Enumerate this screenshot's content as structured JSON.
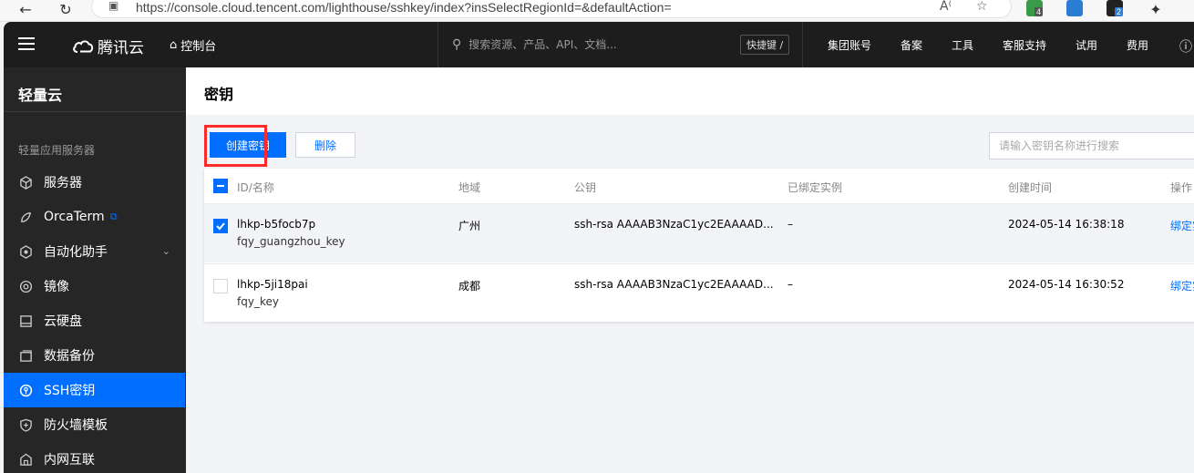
{
  "browser": {
    "url": "https://console.cloud.tencent.com/lighthouse/sshkey/index?insSelectRegionId=&defaultAction=",
    "extensions": [
      {
        "name": "ext-shield",
        "color": "#3a9a4a",
        "badge": "4"
      },
      {
        "name": "ext-note",
        "color": "#2b7cd3",
        "badge": ""
      },
      {
        "name": "ext-dark",
        "color": "#222222",
        "badge": "2"
      }
    ]
  },
  "topnav": {
    "logo_text": "腾讯云",
    "console": "控制台",
    "search_placeholder": "搜索资源、产品、API、文档...",
    "shortcut": "快捷键 /",
    "items": [
      "集团账号",
      "备案",
      "工具",
      "客服支持",
      "试用",
      "费用"
    ]
  },
  "sidebar": {
    "title": "轻量云",
    "section": "轻量应用服务器",
    "items": [
      {
        "label": "服务器",
        "icon": "cube-icon",
        "active": false
      },
      {
        "label": "OrcaTerm",
        "icon": "terminal-icon",
        "active": false,
        "external": true
      },
      {
        "label": "自动化助手",
        "icon": "automation-icon",
        "active": false,
        "expandable": true
      },
      {
        "label": "镜像",
        "icon": "image-icon",
        "active": false
      },
      {
        "label": "云硬盘",
        "icon": "disk-icon",
        "active": false
      },
      {
        "label": "数据备份",
        "icon": "backup-icon",
        "active": false
      },
      {
        "label": "SSH密钥",
        "icon": "key-icon",
        "active": true
      },
      {
        "label": "防火墙模板",
        "icon": "firewall-icon",
        "active": false
      },
      {
        "label": "内网互联",
        "icon": "network-icon",
        "active": false
      }
    ]
  },
  "page": {
    "title": "密钥",
    "create_button": "创建密钥",
    "delete_button": "删除",
    "search_placeholder": "请输入密钥名称进行搜索"
  },
  "table": {
    "headers": [
      "ID/名称",
      "地域",
      "公钥",
      "已绑定实例",
      "创建时间",
      "操作"
    ],
    "rows": [
      {
        "id": "lhkp-b5focb7p",
        "name": "fqy_guangzhou_key",
        "region": "广州",
        "pubkey": "ssh-rsa AAAAB3NzaC1yc2EAAAAD...",
        "instances": "–",
        "created": "2024-05-14 16:38:18",
        "action": "绑定实",
        "checked": true
      },
      {
        "id": "lhkp-5ji18pai",
        "name": "fqy_key",
        "region": "成都",
        "pubkey": "ssh-rsa AAAAB3NzaC1yc2EAAAAD...",
        "instances": "–",
        "created": "2024-05-14 16:30:52",
        "action": "绑定实",
        "checked": false
      }
    ]
  }
}
